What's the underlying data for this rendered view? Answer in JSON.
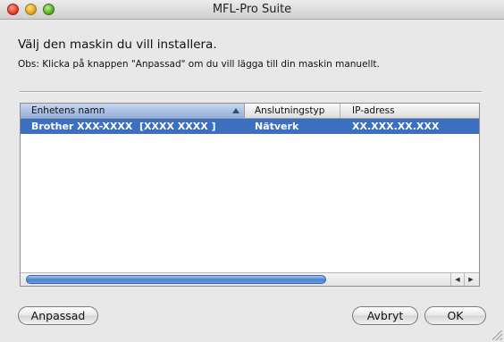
{
  "window": {
    "title": "MFL-Pro Suite"
  },
  "content": {
    "heading": "Välj den maskin du vill installera.",
    "note": "Obs: Klicka på knappen \"Anpassad\" om du vill lägga till din maskin manuellt."
  },
  "table": {
    "columns": [
      "Enhetens namn",
      "Anslutningstyp",
      "IP-adress"
    ],
    "sort_column": "Enhetens namn",
    "sort_direction": "ascending",
    "rows": [
      {
        "name": "Brother XXX-XXXX  [XXXX XXXX ]",
        "connection": "Nätverk",
        "ip": "XX.XXX.XX.XXX",
        "selected": true
      }
    ]
  },
  "buttons": {
    "anpassad": "Anpassad",
    "avbryt": "Avbryt",
    "ok": "OK"
  },
  "colors": {
    "selection": "#3d6fc0",
    "header_sorted": "#93afd9",
    "scroll_thumb": "#4a82cf"
  },
  "icons": {
    "sort": "triangle-up",
    "scroll_left": "triangle-left",
    "scroll_right": "triangle-right"
  }
}
